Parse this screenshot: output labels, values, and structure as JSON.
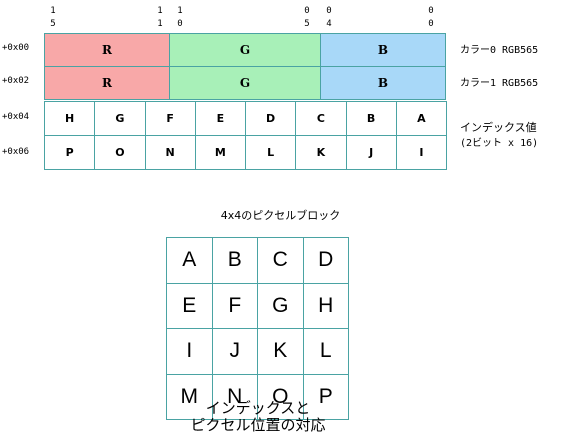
{
  "bit_labels": [
    {
      "top": "1",
      "bottom": "5"
    },
    {
      "top": "1",
      "bottom": "1"
    },
    {
      "top": "1",
      "bottom": "0"
    },
    {
      "top": "0",
      "bottom": "5"
    },
    {
      "top": "0",
      "bottom": "4"
    },
    {
      "top": "0",
      "bottom": "0"
    }
  ],
  "offsets": [
    "+0x00",
    "+0x02",
    "+0x04",
    "+0x06"
  ],
  "color_rows": [
    {
      "fields": [
        "R",
        "G",
        "B"
      ],
      "label": "カラー0 RGB565"
    },
    {
      "fields": [
        "R",
        "G",
        "B"
      ],
      "label": "カラー1 RGB565"
    }
  ],
  "field_colors": {
    "R": "#f8a8a8",
    "G": "#a8f0b8",
    "B": "#a8d8f8"
  },
  "index_rows": [
    [
      "H",
      "G",
      "F",
      "E",
      "D",
      "C",
      "B",
      "A"
    ],
    [
      "P",
      "O",
      "N",
      "M",
      "L",
      "K",
      "J",
      "I"
    ]
  ],
  "index_label_line1": "インデックス値",
  "index_label_line2": "(2ビット x 16)",
  "block_title": "4x4のピクセルブロック",
  "pixel_grid": [
    [
      "A",
      "B",
      "C",
      "D"
    ],
    [
      "E",
      "F",
      "G",
      "H"
    ],
    [
      "I",
      "J",
      "K",
      "L"
    ],
    [
      "M",
      "N",
      "O",
      "P"
    ]
  ],
  "caption_line1": "インデックスと",
  "caption_line2": "ピクセル位置の対応"
}
